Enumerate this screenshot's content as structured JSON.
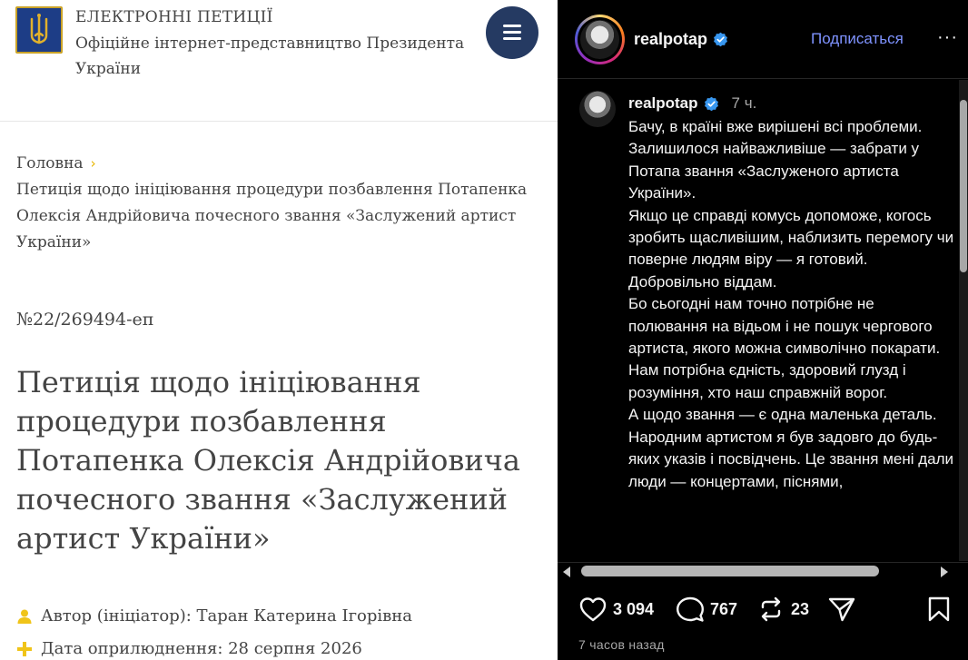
{
  "petition_site": {
    "site_title": "ЕЛЕКТРОННІ ПЕТИЦІЇ",
    "site_subtitle": "Офіційне інтернет-представництво Президента України",
    "breadcrumb_home": "Головна",
    "breadcrumb_current": "Петиція щодо ініціювання процедури позбавлення Потапенка Олексія Андрійовича почесного звання «Заслужений артист України»",
    "petition_number": "№22/269494-еп",
    "petition_title": "Петиція щодо ініціювання процедури позбавлення Потапенка Олексія Андрійовича почесного звання «Заслужений артист України»",
    "author": "Автор (ініціатор): Таран Катерина Ігорівна",
    "published": "Дата оприлюднення: 28 серпня 2026",
    "colors": {
      "menu_button": "#253a62",
      "accent": "#e8b600",
      "emblem": "#1d3d86"
    }
  },
  "instagram": {
    "username": "realpotap",
    "follow_label": "Подписаться",
    "more_label": "···",
    "comment": {
      "username": "realpotap",
      "time": "7 ч.",
      "paragraphs": [
        "Бачу, в країні вже вирішені всі проблеми. Залишилося найважливіше — забрати у Потапа звання «Заслуженого артиста України».",
        "Якщо це справді комусь допоможе, когось зробить щасливішим, наблизить перемогу чи поверне людям віру — я готовий. Добровільно віддам.",
        "Бо сьогодні нам точно потрібне не полювання на відьом і не пошук чергового артиста, якого можна символічно покарати. Нам потрібна єдність, здоровий глузд і розуміння, хто наш справжній ворог.",
        "А щодо звання — є одна маленька деталь. Народним артистом я був задовго до будь-яких указів і посвідчень. Це звання мені дали люди — концертами, піснями,"
      ]
    },
    "likes": "3 094",
    "comments": "767",
    "reposts": "23",
    "posted_ago": "7 часов назад",
    "colors": {
      "follow": "#7f93ff",
      "verified": "#3897f0"
    }
  }
}
